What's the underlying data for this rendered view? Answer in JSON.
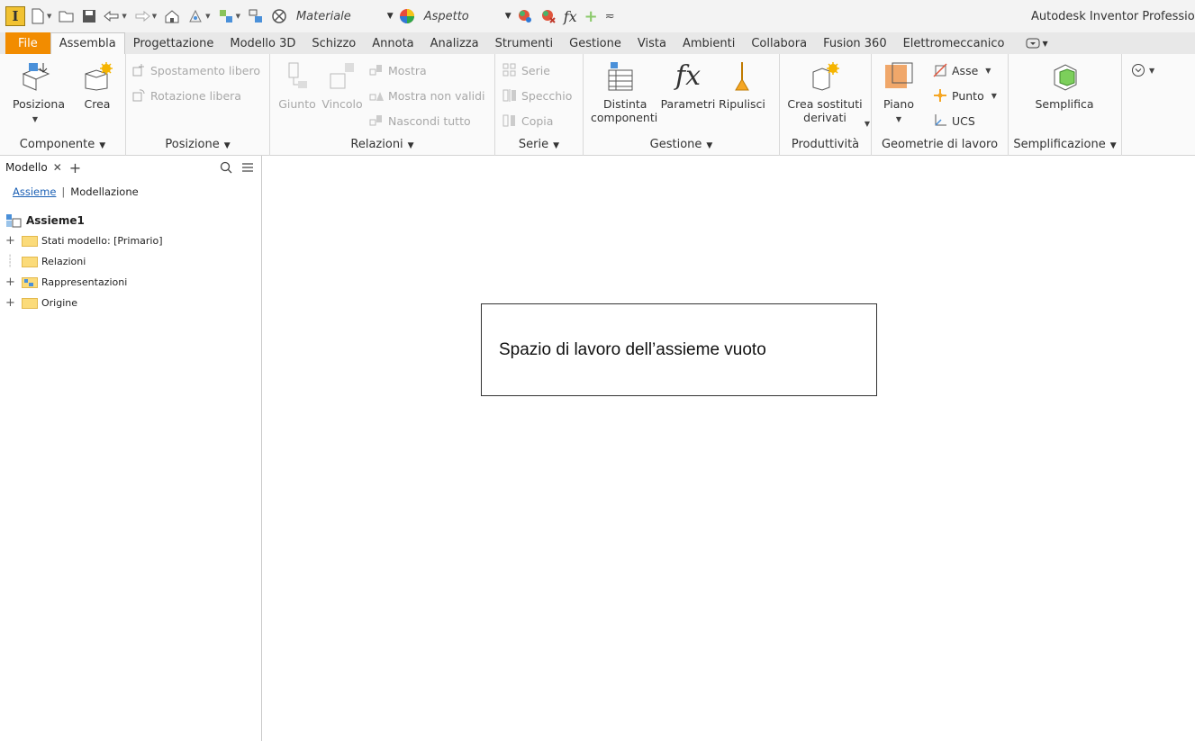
{
  "qat": {
    "logo": "I",
    "material": "Materiale",
    "appearance": "Aspetto",
    "app_title": "Autodesk Inventor Professional",
    "icons": [
      "new-icon",
      "open-icon",
      "save-icon",
      "undo-icon",
      "redo-icon",
      "home-icon",
      "update-icon",
      "select-icon",
      "snapshot-icon",
      "color-icon",
      "appearance-icon",
      "adjust-icon",
      "clear-icon",
      "fx-icon",
      "plus-icon",
      "customize-icon"
    ]
  },
  "tabs": [
    "File",
    "Assembla",
    "Progettazione",
    "Modello 3D",
    "Schizzo",
    "Annota",
    "Analizza",
    "Strumenti",
    "Gestione",
    "Vista",
    "Ambienti",
    "Collabora",
    "Fusion 360",
    "Elettromeccanico"
  ],
  "active_tab": "Assembla",
  "ribbon": {
    "componente": {
      "title": "Componente",
      "posiziona": "Posiziona",
      "crea": "Crea"
    },
    "posizione": {
      "title": "Posizione",
      "spostamento": "Spostamento libero",
      "rotazione": "Rotazione libera"
    },
    "relazioni": {
      "title": "Relazioni",
      "giunto": "Giunto",
      "vincolo": "Vincolo",
      "mostra": "Mostra",
      "mostra_non_validi": "Mostra non validi",
      "nascondi_tutto": "Nascondi tutto"
    },
    "serie": {
      "title": "Serie",
      "serie": "Serie",
      "specchio": "Specchio",
      "copia": "Copia"
    },
    "gestione": {
      "title": "Gestione",
      "distinta_1": "Distinta",
      "distinta_2": "componenti",
      "parametri": "Parametri",
      "ripulisci": "Ripulisci"
    },
    "produttivita": {
      "title": "Produttività",
      "crea_sostituti_1": "Crea sostituti",
      "crea_sostituti_2": "derivati"
    },
    "geometrie": {
      "title": "Geometrie di lavoro",
      "piano": "Piano",
      "asse": "Asse",
      "punto": "Punto",
      "ucs": "UCS"
    },
    "semplificazione": {
      "title": "Semplificazione",
      "semplifica": "Semplifica"
    }
  },
  "browser": {
    "tab_label": "Modello",
    "subtabs": {
      "assieme": "Assieme",
      "modellazione": "Modellazione"
    },
    "tree": {
      "root": "Assieme1",
      "items": [
        "Stati modello: [Primario]",
        "Relazioni",
        "Rappresentazioni",
        "Origine"
      ]
    }
  },
  "canvas": {
    "note": "Spazio di lavoro dell’assieme vuoto"
  },
  "colors": {
    "file_tab": "#f28c00",
    "folder": "#fbdb7a",
    "accent": "#1a5fb4"
  }
}
